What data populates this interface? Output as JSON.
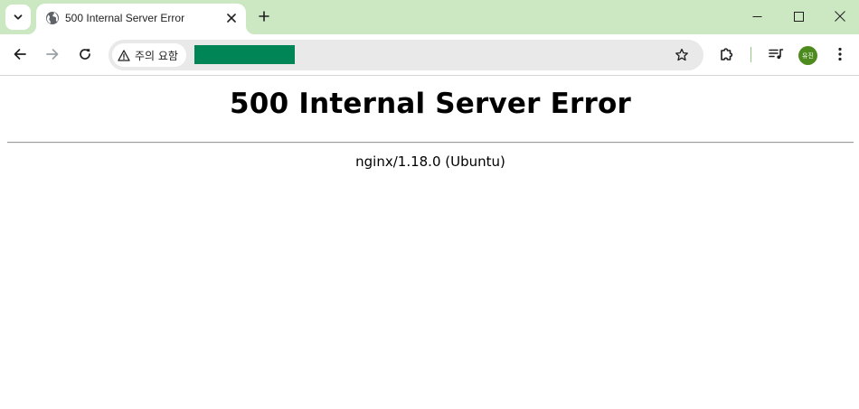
{
  "browser": {
    "tab": {
      "title": "500 Internal Server Error"
    },
    "omnibox": {
      "security_label": "주의 요함"
    },
    "profile": {
      "initials": "유진",
      "color": "#4d8b1e"
    },
    "theme": {
      "tabstrip_color": "#cbe8c2",
      "redaction_color": "#008556"
    }
  },
  "page": {
    "heading": "500 Internal Server Error",
    "server_info": "nginx/1.18.0 (Ubuntu)"
  }
}
